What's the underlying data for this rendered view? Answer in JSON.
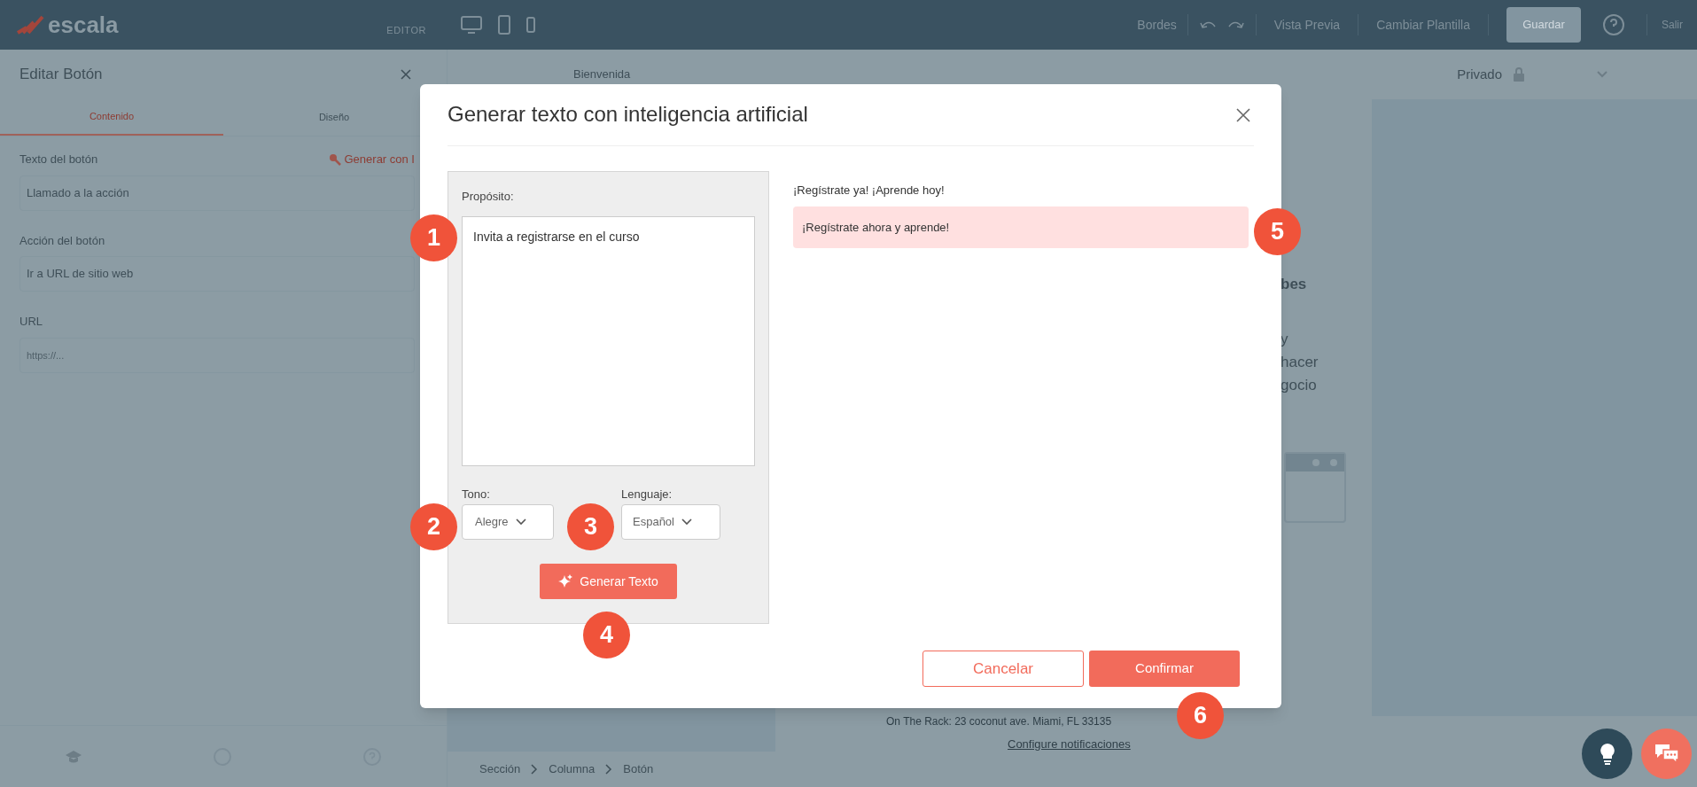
{
  "topbar": {
    "logo": "escala",
    "mode": "EDITOR",
    "borders": "Bordes",
    "preview": "Vista Previa",
    "template": "Cambiar Plantilla",
    "save": "Guardar",
    "exit": "Salir"
  },
  "left_panel": {
    "title": "Editar Botón",
    "tabs": [
      {
        "label": "Contenido",
        "selected": true
      },
      {
        "label": "Diseño",
        "selected": false
      }
    ],
    "button_text_label": "Texto del botón",
    "ai_link": "Generar con I",
    "button_text_value": "Llamado a la acción",
    "action_label": "Acción del botón",
    "action_value": "Ir a URL de sitio web",
    "url_label": "URL",
    "url_placeholder": "https://..."
  },
  "page_header": {
    "page": "Bienvenida",
    "visibility": "Privado"
  },
  "canvas": {
    "fragments": [
      {
        "text": "bes",
        "kind": "bold"
      },
      {
        "text": "y",
        "kind": "plain"
      },
      {
        "text": "hacer",
        "kind": "plain"
      },
      {
        "text": "gocio",
        "kind": "plain"
      }
    ],
    "footer_address": "On The Rack: 23 coconut ave. Miami, FL 33135",
    "footer_link": "Configure notificaciones"
  },
  "breadcrumb": [
    "Sección",
    "Columna",
    "Botón"
  ],
  "modal": {
    "title": "Generar texto con inteligencia artificial",
    "purpose_label": "Propósito:",
    "purpose_value": "Invita a registrarse en el curso",
    "tone_label": "Tono:",
    "tone_value": "Alegre",
    "language_label": "Lenguaje:",
    "language_value": "Español",
    "generate": "Generar Texto",
    "results": [
      {
        "text": "¡Regístrate ya! ¡Aprende hoy!",
        "selected": false
      },
      {
        "text": "¡Regístrate ahora y aprende!",
        "selected": true
      }
    ],
    "cancel": "Cancelar",
    "confirm": "Confirmar"
  },
  "callouts": [
    "1",
    "2",
    "3",
    "4",
    "5",
    "6"
  ]
}
